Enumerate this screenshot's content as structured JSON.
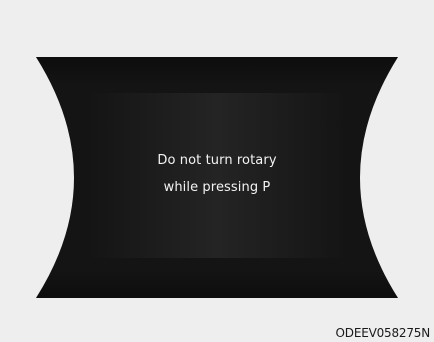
{
  "display": {
    "message_line_1": "Do not turn rotary",
    "message_line_2": "while pressing P"
  },
  "caption": {
    "image_code": "ODEEV058275N"
  },
  "colors": {
    "page_background": "#eeeeef",
    "panel_outer": "#141414",
    "panel_inner": "#1e1e1e",
    "text": "#f3f3f3",
    "caption_text": "#1a1a1a"
  }
}
